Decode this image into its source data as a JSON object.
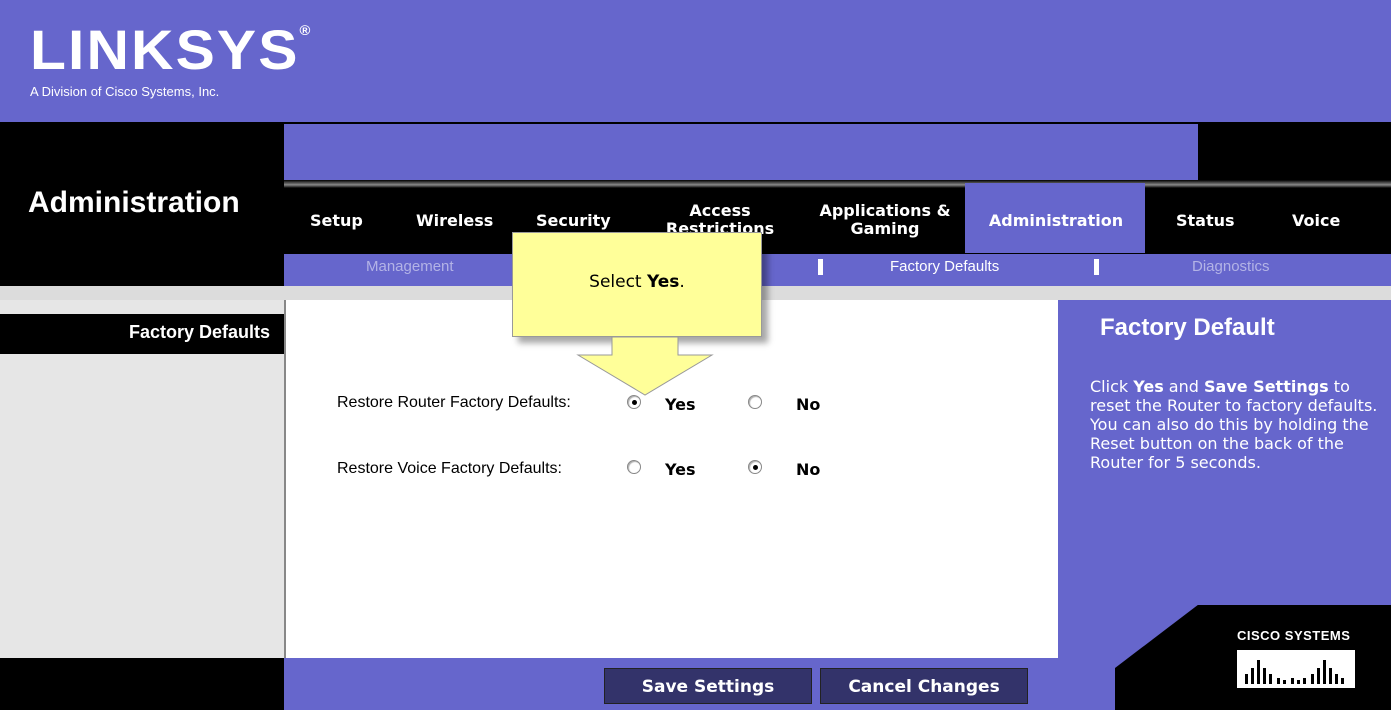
{
  "brand": {
    "logo": "LINKSYS",
    "sub": "A Division of Cisco Systems, Inc."
  },
  "section_title": "Administration",
  "tabs": [
    {
      "label": "Setup"
    },
    {
      "label": "Wireless"
    },
    {
      "label": "Security"
    },
    {
      "label": "Access Restrictions"
    },
    {
      "label": "Applications & Gaming"
    },
    {
      "label": "Administration",
      "active": true
    },
    {
      "label": "Status"
    },
    {
      "label": "Voice"
    }
  ],
  "subnav": [
    {
      "label": "Management"
    },
    {
      "label": "Factory Defaults",
      "active": true
    },
    {
      "label": "Diagnostics"
    }
  ],
  "left_label": "Factory Defaults",
  "form": {
    "router_label": "Restore Router Factory Defaults:",
    "voice_label": "Restore Voice Factory Defaults:",
    "yes": "Yes",
    "no": "No",
    "router_value": "Yes",
    "voice_value": "No"
  },
  "help": {
    "title": "Factory Default",
    "text_parts": [
      "Click ",
      "Yes",
      " and ",
      "Save Settings",
      " to reset the Router to factory defaults. You can also do this by holding the Reset button on the back of the Router for 5 seconds."
    ]
  },
  "cisco": "CISCO SYSTEMS",
  "buttons": {
    "save": "Save Settings",
    "cancel": "Cancel Changes"
  },
  "callout": {
    "prefix": "Select ",
    "bold": "Yes",
    "suffix": "."
  },
  "colors": {
    "purple": "#6666cc",
    "black": "#000000",
    "callout": "#ffff99",
    "button": "#33336a"
  }
}
